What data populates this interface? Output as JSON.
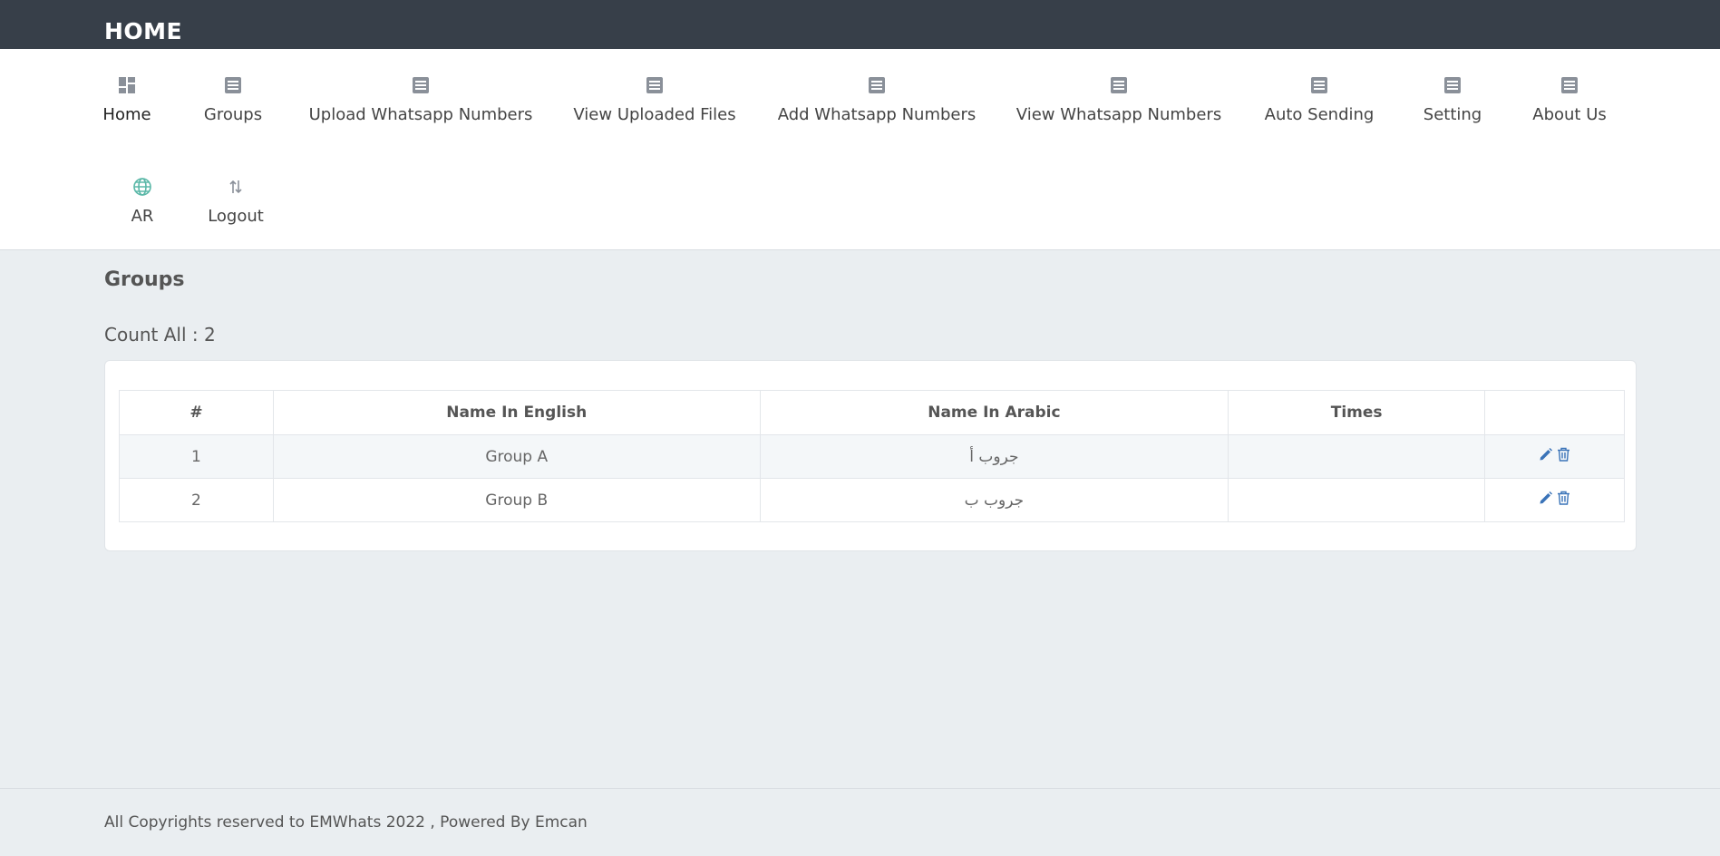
{
  "header": {
    "title": "HOME"
  },
  "nav": {
    "items": [
      {
        "label": "Home",
        "icon": "dashboard-icon"
      },
      {
        "label": "Groups",
        "icon": "document-icon"
      },
      {
        "label": "Upload Whatsapp Numbers",
        "icon": "document-icon"
      },
      {
        "label": "View Uploaded Files",
        "icon": "document-icon"
      },
      {
        "label": "Add Whatsapp Numbers",
        "icon": "document-icon"
      },
      {
        "label": "View Whatsapp Numbers",
        "icon": "document-icon"
      },
      {
        "label": "Auto Sending",
        "icon": "document-icon"
      },
      {
        "label": "Setting",
        "icon": "document-icon"
      },
      {
        "label": "About Us",
        "icon": "document-icon"
      },
      {
        "label": "AR",
        "icon": "globe-icon"
      },
      {
        "label": "Logout",
        "icon": "arrows-updown-icon"
      }
    ]
  },
  "main": {
    "title": "Groups",
    "count_label": "Count All : 2",
    "table": {
      "columns": [
        "#",
        "Name In English",
        "Name In Arabic",
        "Times",
        ""
      ],
      "rows": [
        {
          "num": "1",
          "name_en": "Group A",
          "name_ar": "جروب أ",
          "times": ""
        },
        {
          "num": "2",
          "name_en": "Group B",
          "name_ar": "جروب ب",
          "times": ""
        }
      ]
    }
  },
  "footer": {
    "text": "All Copyrights reserved to EMWhats 2022 , Powered By Emcan"
  },
  "colors": {
    "topbar": "#373f49",
    "background": "#eaeef1",
    "icon_gray": "#8a9099",
    "globe_teal": "#5bb8a8",
    "action_blue": "#3a73b8"
  }
}
